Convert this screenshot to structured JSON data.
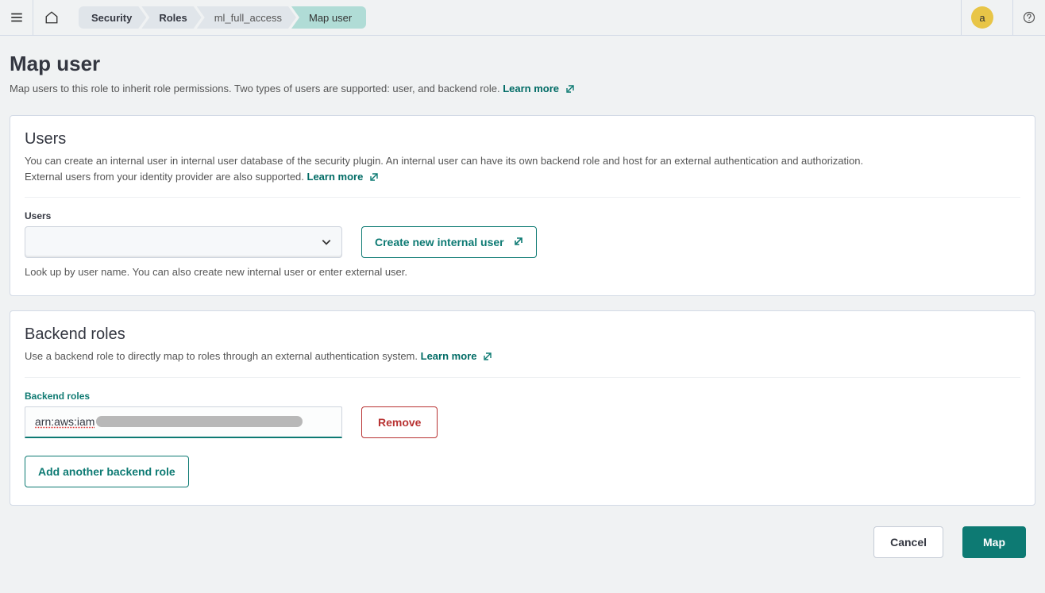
{
  "header": {
    "breadcrumbs": [
      {
        "label": "Security"
      },
      {
        "label": "Roles"
      },
      {
        "label": "ml_full_access"
      },
      {
        "label": "Map user"
      }
    ],
    "avatar_letter": "a"
  },
  "page": {
    "title": "Map user",
    "description": "Map users to this role to inherit role permissions. Two types of users are supported: user, and backend role.",
    "learn_more": "Learn more"
  },
  "users_panel": {
    "title": "Users",
    "description_line1": "You can create an internal user in internal user database of the security plugin. An internal user can have its own backend role and host for an external authentication and authorization.",
    "description_line2": "External users from your identity provider are also supported.",
    "learn_more": "Learn more",
    "field_label": "Users",
    "create_button": "Create new internal user",
    "help_text": "Look up by user name. You can also create new internal user or enter external user."
  },
  "backend_panel": {
    "title": "Backend roles",
    "description": "Use a backend role to directly map to roles through an external authentication system.",
    "learn_more": "Learn more",
    "field_label": "Backend roles",
    "input_value_visible": "arn:aws:iam",
    "remove_button": "Remove",
    "add_button": "Add another backend role"
  },
  "footer": {
    "cancel": "Cancel",
    "map": "Map"
  }
}
